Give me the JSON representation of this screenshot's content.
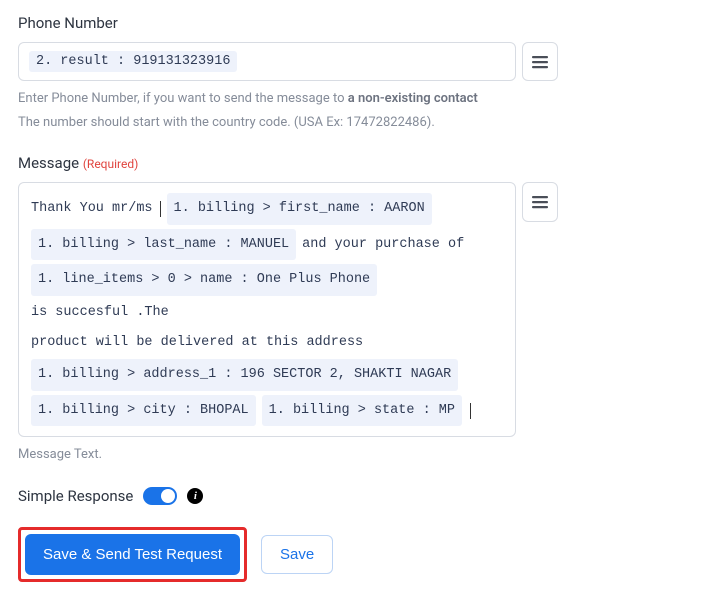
{
  "phone": {
    "label": "Phone Number",
    "chip": "2. result : 919131323916",
    "help_prefix": "Enter Phone Number, if you want to send the message to ",
    "help_bold": "a non-existing contact",
    "help_line2": "The number should start with the country code. (USA Ex: 17472822486)."
  },
  "message": {
    "label": "Message",
    "required": "(Required)",
    "txt_thank": "Thank You mr/ms",
    "chip_first": "1. billing > first_name : AARON",
    "chip_last": "1. billing > last_name : MANUEL",
    "txt_purchase": " and your purchase of",
    "chip_item": "1. line_items > 0 > name : One Plus Phone",
    "txt_success": " is succesful .The",
    "txt_delivered": "product will be delivered at this address",
    "chip_addr": "1. billing > address_1 : 196 SECTOR 2, SHAKTI NAGAR",
    "chip_city": "1. billing > city : BHOPAL",
    "chip_state": "1. billing > state : MP",
    "help": "Message Text."
  },
  "simple_response": {
    "label": "Simple Response",
    "on": true
  },
  "buttons": {
    "save_send": "Save & Send Test Request",
    "save": "Save"
  }
}
